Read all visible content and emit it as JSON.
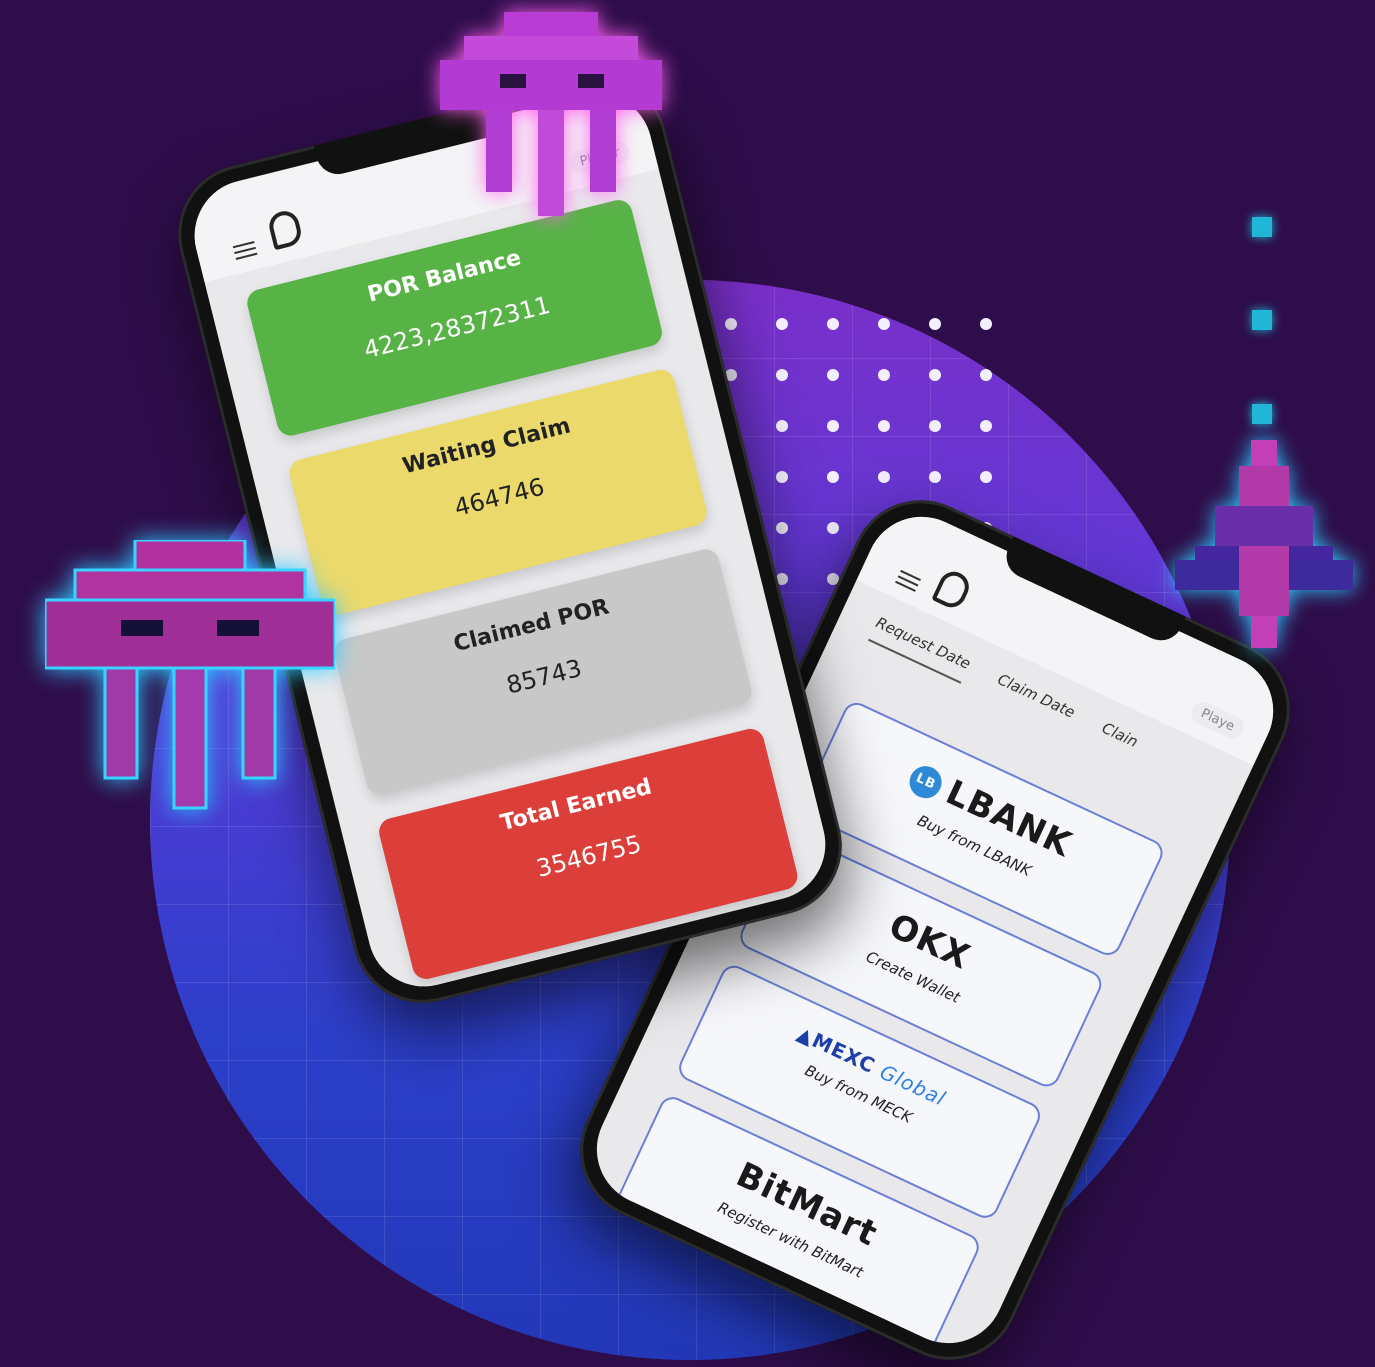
{
  "phone1": {
    "menu_icon": "hamburger-menu-icon",
    "logo_icon": "pinkcoin-logo-icon",
    "player_label": "Player",
    "cards": [
      {
        "title": "POR Balance",
        "value": "4223,28372311",
        "color": "#58b347"
      },
      {
        "title": "Waiting Claim",
        "value": "464746",
        "color": "#ebd96b"
      },
      {
        "title": "Claimed POR",
        "value": "85743",
        "color": "#c8c8c8"
      },
      {
        "title": "Total Earned",
        "value": "3546755",
        "color": "#dc3e3a"
      }
    ]
  },
  "phone2": {
    "player_label": "Playe",
    "tabs": [
      "Request Date",
      "Claim Date",
      "Clain"
    ],
    "exchanges": [
      {
        "name": "LBANK",
        "subtitle": "Buy from LBANK",
        "icon": "lbank-logo-icon"
      },
      {
        "name": "OKX",
        "subtitle": "Create Wallet",
        "icon": "okx-logo-icon"
      },
      {
        "name": "MEXC",
        "name_suffix": "Global",
        "subtitle": "Buy from MECK",
        "icon": "mexc-logo-icon"
      },
      {
        "name": "BitMart",
        "subtitle": "Register with BitMart",
        "icon": "bitmart-logo-icon"
      }
    ]
  },
  "colors": {
    "background": "#2e0d4a",
    "circle_top": "#7a2fc9",
    "circle_bottom": "#2238b8",
    "invader_pink": "#c02fc2",
    "glow_cyan": "#21b5d6"
  }
}
